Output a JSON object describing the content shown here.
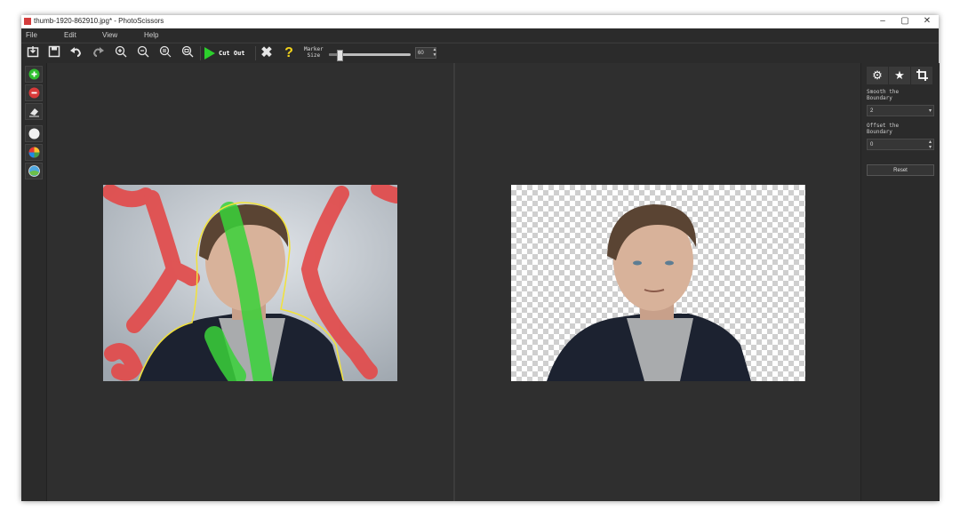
{
  "window": {
    "title": "thumb-1920-862910.jpg* - PhotoScissors",
    "controls": [
      "–",
      "▢",
      "✕"
    ]
  },
  "menu": [
    "File",
    "Edit",
    "View",
    "Help"
  ],
  "toolbar": {
    "icons": [
      "open-icon",
      "save-icon",
      "undo-icon",
      "redo-icon",
      "zoom-in-icon",
      "zoom-out-icon",
      "zoom-actual-icon",
      "zoom-fit-icon"
    ],
    "cut_out_label": "Cut Out",
    "marker_label_line1": "Marker",
    "marker_label_line2": "Size",
    "marker_size": "60",
    "marker_fraction": 0.12
  },
  "left_tools": [
    "foreground-marker-icon",
    "background-marker-icon",
    "eraser-icon",
    "white-bg-icon",
    "color-bg-icon",
    "image-bg-icon"
  ],
  "right_panel": {
    "tabs": [
      "settings-icon",
      "star-icon",
      "crop-icon"
    ],
    "smooth_label_line1": "Smooth the",
    "smooth_label_line2": "Boundary",
    "smooth_value": "2",
    "offset_label_line1": "Offset the",
    "offset_label_line2": "Boundary",
    "offset_value": "0",
    "reset_label": "Reset"
  },
  "colors": {
    "foreground_marker": "#3ad23a",
    "background_marker": "#e34b4b",
    "boundary": "#f2e23a"
  }
}
